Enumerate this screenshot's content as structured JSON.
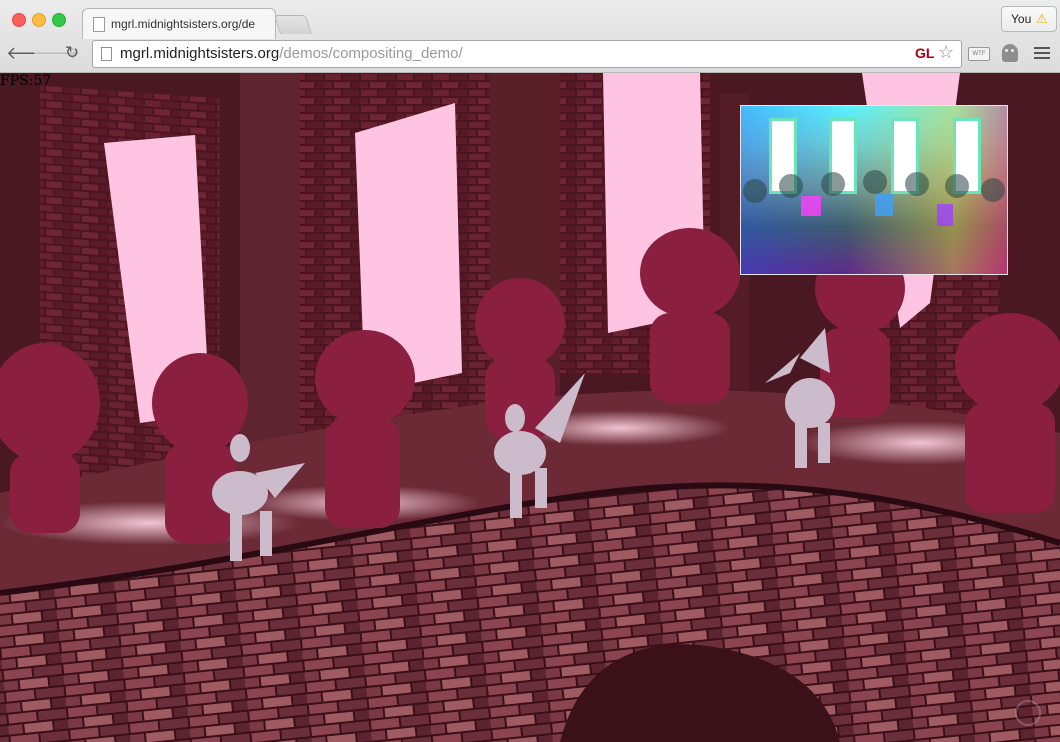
{
  "browser": {
    "tab_title": "mgrl.midnightsisters.org/de",
    "url_host": "mgrl.midnightsisters.org",
    "url_path": "/demos/compositing_demo/",
    "profile_label": "You",
    "gl_badge": "GL",
    "ext_label": "WTF",
    "icons": {
      "back": "arrow-left-icon",
      "forward": "arrow-right-icon",
      "reload": "reload-icon",
      "bookmark": "star-icon",
      "menu": "hamburger-icon",
      "warning": "warning-icon"
    }
  },
  "canvas": {
    "fps_label": "FPS:57"
  },
  "colors": {
    "sky": "#ffc4e1",
    "brick": "#5a1c26",
    "goblin": "#8a1f40",
    "gargoyle": "#ccbccb",
    "gl_badge": "#b00010"
  }
}
